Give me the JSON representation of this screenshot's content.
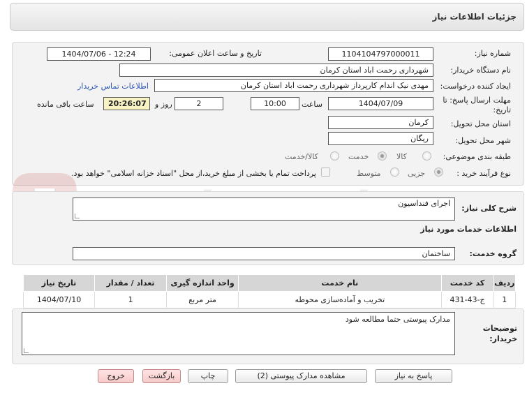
{
  "header": {
    "title": "جزئیات اطلاعات نیاز"
  },
  "fields": {
    "need_number_label": "شماره نیاز:",
    "need_number": "1104104797000011",
    "announce_label": "تاریخ و ساعت اعلان عمومی:",
    "announce_value": "1404/07/06 - 12:24",
    "buyer_org_label": "نام دستگاه خریدار:",
    "buyer_org": "شهرداری رحمت اباد استان کرمان",
    "creator_label": "ایجاد کننده درخواست:",
    "creator": "مهدی نیک اندام کارپرداز شهرداری رحمت اباد استان کرمان",
    "contact_link": "اطلاعات تماس خریدار",
    "deadline_label": "مهلت ارسال پاسخ: تا تاریخ:",
    "deadline_date": "1404/07/09",
    "time_label": "ساعت",
    "deadline_time": "10:00",
    "days_value": "2",
    "days_label": "روز و",
    "remaining_time": "20:26:07",
    "remaining_label": "ساعت باقی مانده",
    "province_label": "استان محل تحویل:",
    "province": "کرمان",
    "city_label": "شهر محل تحویل:",
    "city": "ریگان",
    "category_label": "طبقه بندی موضوعی:",
    "category_options": [
      "کالا",
      "خدمت",
      "کالا/خدمت"
    ],
    "process_label": "نوع فرآیند خرید :",
    "process_options": [
      "جزیی",
      "متوسط"
    ],
    "payment_note": "پرداخت تمام یا بخشی از مبلغ خرید،از محل \"اسناد خزانه اسلامی\" خواهد بود."
  },
  "summary": {
    "label": "شرح کلی نیاز:",
    "value": "اجرای فنداسیون"
  },
  "services": {
    "section_title": "اطلاعات خدمات مورد نیاز",
    "group_label": "گروه خدمت:",
    "group_value": "ساختمان",
    "columns": [
      "ردیف",
      "کد خدمت",
      "نام خدمت",
      "واحد اندازه گیری",
      "تعداد / مقدار",
      "تاریخ نیاز"
    ],
    "rows": [
      [
        "1",
        "ج-43-431",
        "تخریب و آماده‌سازی محوطه",
        "متر مربع",
        "1",
        "1404/07/10"
      ]
    ]
  },
  "buyer_notes": {
    "label": "توضیحات خریدار:",
    "value": "مدارک پیوستی حتما مطالعه شود"
  },
  "watermark": {
    "text": "AriaTender.net"
  },
  "buttons": {
    "reply": "پاسخ به نیاز",
    "attachments": "مشاهده مدارک پیوستی (2)",
    "print": "چاپ",
    "back": "بازگشت",
    "exit": "خروج"
  }
}
